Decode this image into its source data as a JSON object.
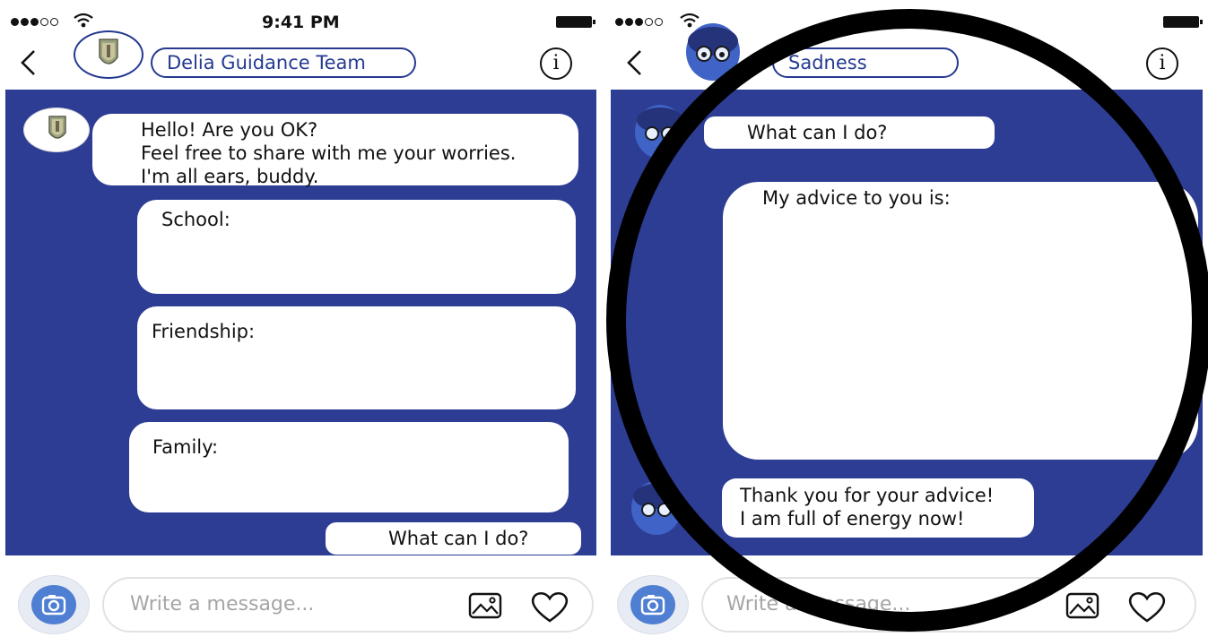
{
  "status": {
    "time": "9:41 PM"
  },
  "left": {
    "title": "Delia Guidance Team",
    "greeting": {
      "line1": "Hello! Are you OK?",
      "line2": "Feel free to share with me your worries.",
      "line3": "I'm all ears, buddy."
    },
    "topics": {
      "school": "School:",
      "friendship": "Friendship:",
      "family": "Family:"
    },
    "question": "What can I do?",
    "composer_placeholder": "Write a message..."
  },
  "right": {
    "title": "Sadness",
    "question": "What can I do?",
    "advice": "My advice to you is:",
    "thanks": {
      "line1": "Thank you for your advice!",
      "line2": "I am full of energy now!"
    },
    "composer_placeholder": "Write a message..."
  },
  "icons": {
    "back": "chevron-left-icon",
    "info": "info-icon",
    "camera": "camera-icon",
    "gallery": "image-icon",
    "like": "heart-icon",
    "signal": "signal-dots-icon",
    "wifi": "wifi-icon",
    "battery": "battery-icon"
  },
  "colors": {
    "chat_background": "#2d3d94",
    "accent": "#253a90",
    "camera_button": "#4f7fd2",
    "overlay_circle": "#000000"
  }
}
